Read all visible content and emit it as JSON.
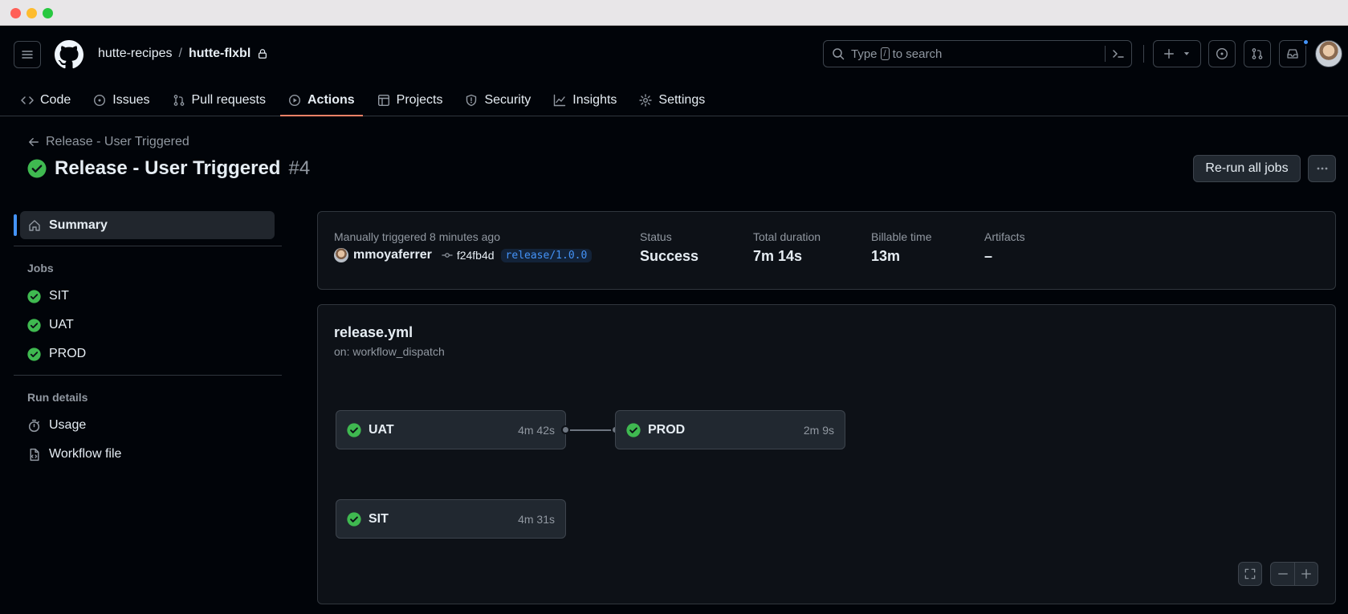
{
  "repo": {
    "owner": "hutte-recipes",
    "separator": "/",
    "name": "hutte-flxbl"
  },
  "search": {
    "before": "Type",
    "key": "/",
    "after": "to search"
  },
  "nav": [
    {
      "label": "Code",
      "icon": "code-icon"
    },
    {
      "label": "Issues",
      "icon": "issue-icon"
    },
    {
      "label": "Pull requests",
      "icon": "pull-request-icon"
    },
    {
      "label": "Actions",
      "icon": "play-icon",
      "active": true
    },
    {
      "label": "Projects",
      "icon": "table-icon"
    },
    {
      "label": "Security",
      "icon": "shield-icon"
    },
    {
      "label": "Insights",
      "icon": "graph-icon"
    },
    {
      "label": "Settings",
      "icon": "gear-icon"
    }
  ],
  "run": {
    "back_label": "Release - User Triggered",
    "title": "Release - User Triggered",
    "number": "#4",
    "rerun_label": "Re-run all jobs"
  },
  "sidebar": {
    "summary_label": "Summary",
    "jobs_heading": "Jobs",
    "jobs": [
      "SIT",
      "UAT",
      "PROD"
    ],
    "details_heading": "Run details",
    "usage_label": "Usage",
    "workflow_file_label": "Workflow file"
  },
  "summary": {
    "trigger": "Manually triggered 8 minutes ago",
    "actor": "mmoyaferrer",
    "commit": "f24fb4d",
    "branch": "release/1.0.0",
    "status_label": "Status",
    "status_value": "Success",
    "duration_label": "Total duration",
    "duration_value": "7m 14s",
    "billable_label": "Billable time",
    "billable_value": "13m",
    "artifacts_label": "Artifacts",
    "artifacts_value": "–"
  },
  "workflow": {
    "file": "release.yml",
    "trigger": "on: workflow_dispatch",
    "jobs": {
      "uat": {
        "name": "UAT",
        "duration": "4m 42s"
      },
      "prod": {
        "name": "PROD",
        "duration": "2m 9s"
      },
      "sit": {
        "name": "SIT",
        "duration": "4m 31s"
      }
    }
  },
  "colors": {
    "success": "#3fb950",
    "accent": "#4493f8",
    "active_tab": "#f78166",
    "background": "#010409"
  }
}
